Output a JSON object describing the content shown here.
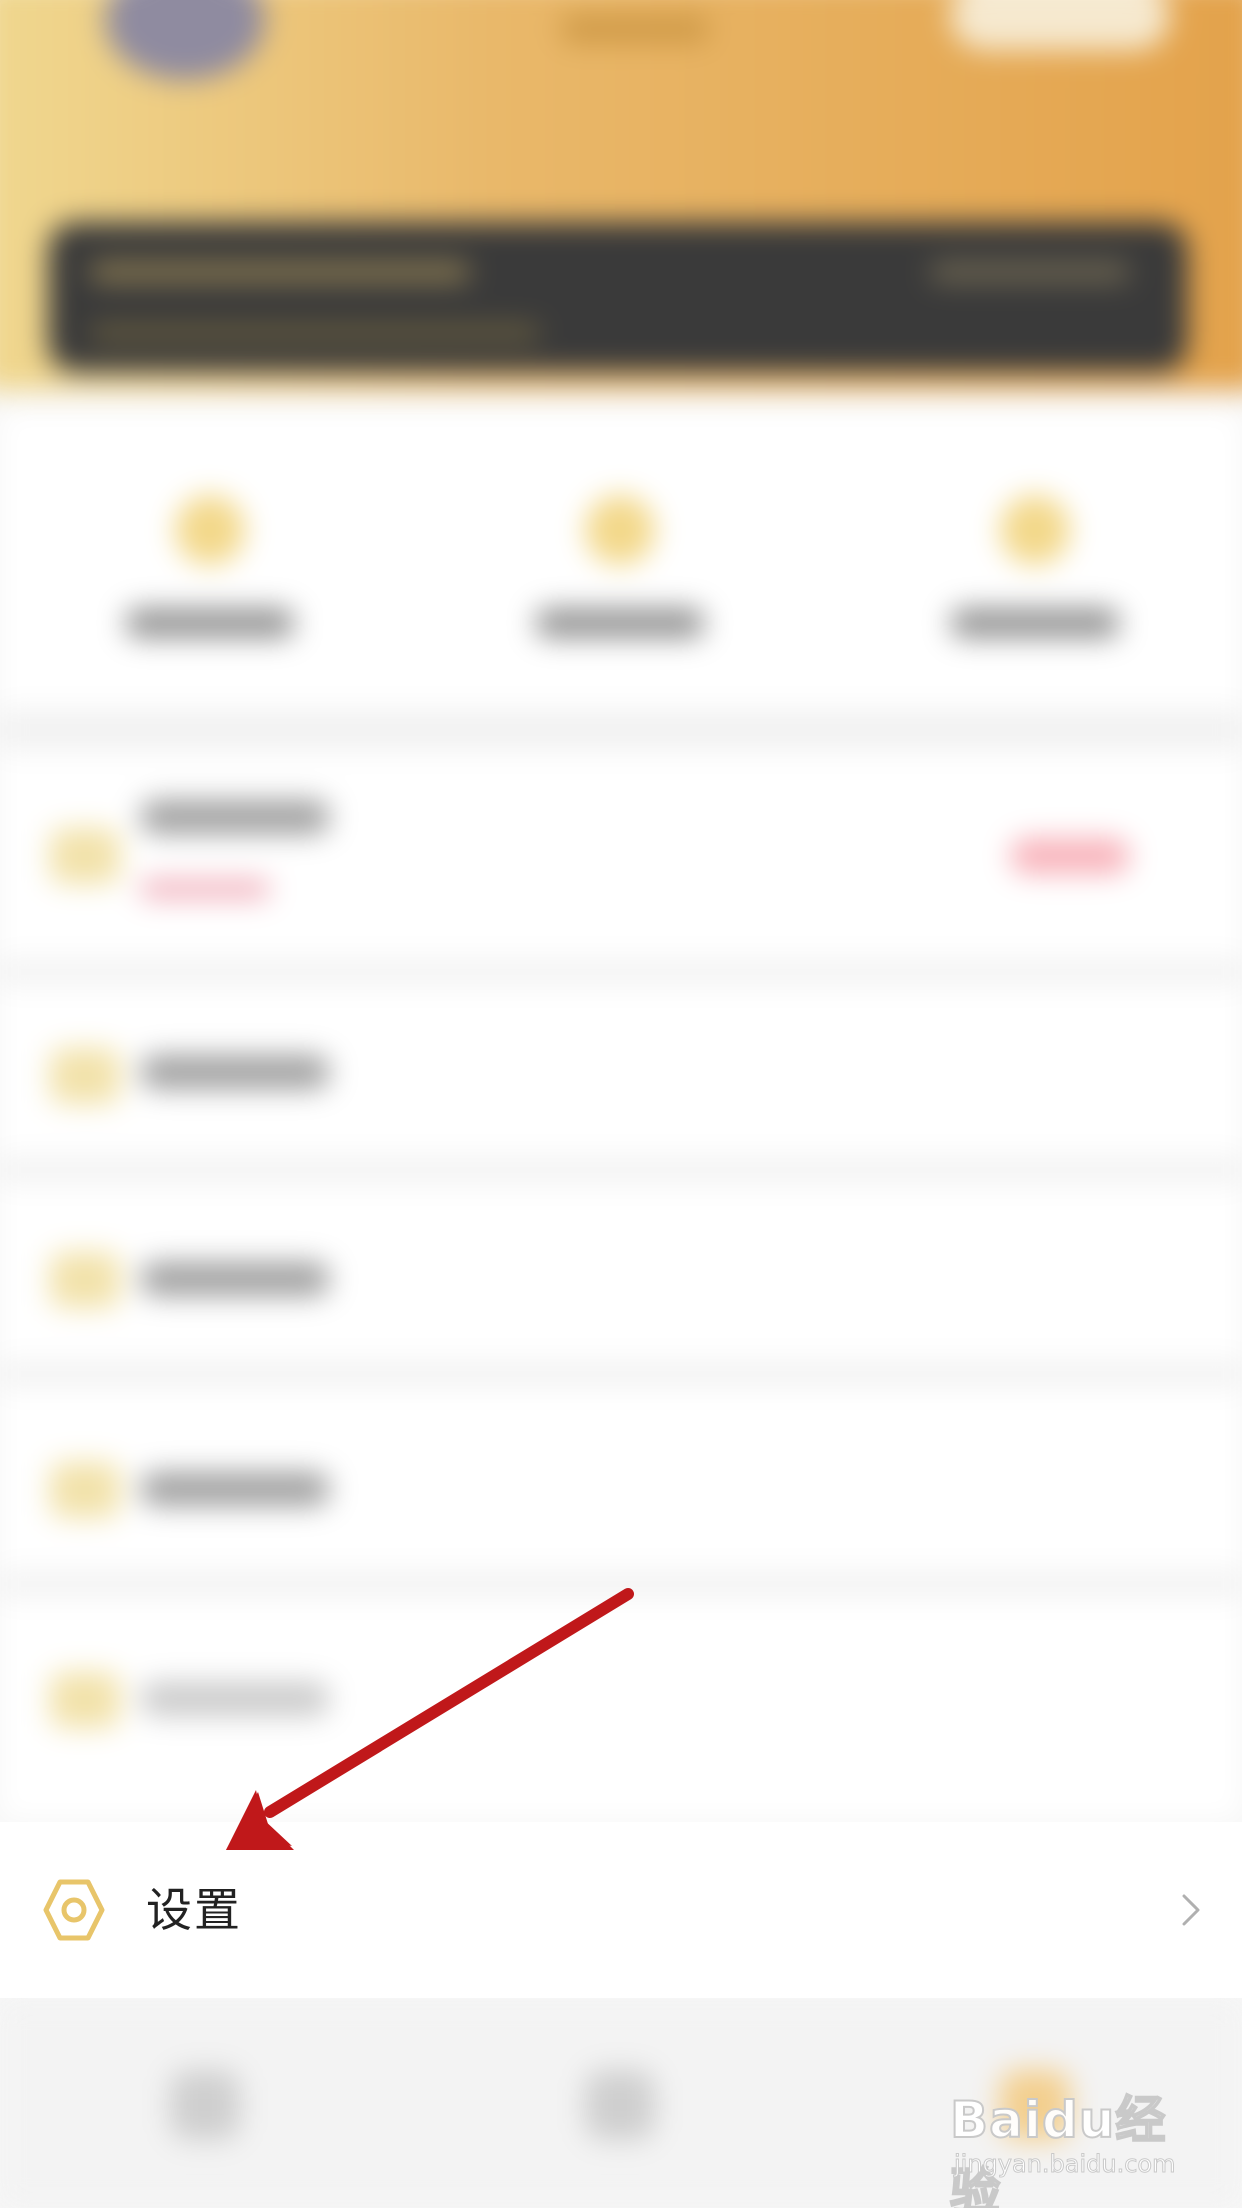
{
  "settings_row": {
    "label": "设置",
    "icon": "gear-icon",
    "chevron": "chevron-right-icon"
  },
  "watermark": {
    "brand": "Baidu经验",
    "url": "jingyan.baidu.com"
  },
  "colors": {
    "accent_gold": "#e8c56a",
    "header_gradient_start": "#f0d890",
    "header_gradient_end": "#e3a24b",
    "annotation_arrow": "#c0181a",
    "label_text": "#222222",
    "chevron": "#b0b0b0"
  }
}
